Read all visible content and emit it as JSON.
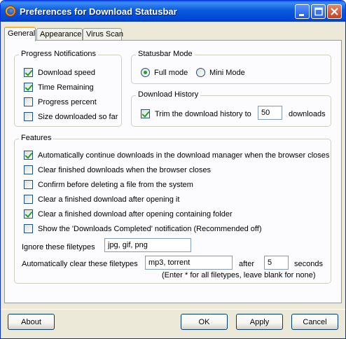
{
  "window": {
    "title": "Preferences for Download Statusbar",
    "title_bar_color": "#0054e3"
  },
  "tabs": [
    {
      "label": "General",
      "active": true
    },
    {
      "label": "Appearance",
      "active": false
    },
    {
      "label": "Virus Scan",
      "active": false
    }
  ],
  "progress_notifications": {
    "legend": "Progress Notifications",
    "options": [
      {
        "label": "Download speed",
        "checked": true
      },
      {
        "label": "Time Remaining",
        "checked": true
      },
      {
        "label": "Progress percent",
        "checked": false
      },
      {
        "label": "Size downloaded so far",
        "checked": false
      }
    ]
  },
  "statusbar_mode": {
    "legend": "Statusbar Mode",
    "options": [
      {
        "label": "Full mode",
        "selected": true
      },
      {
        "label": "Mini Mode",
        "selected": false
      }
    ]
  },
  "download_history": {
    "legend": "Download History",
    "trim_label": "Trim the download history to",
    "trim_checked": true,
    "trim_value": "50",
    "unit": "downloads"
  },
  "features": {
    "legend": "Features",
    "options": [
      {
        "label": "Automatically continue downloads in the download manager when the browser closes",
        "checked": true
      },
      {
        "label": "Clear finished downloads when the browser closes",
        "checked": false
      },
      {
        "label": "Confirm before deleting a file from the system",
        "checked": false
      },
      {
        "label": "Clear a finished download after opening it",
        "checked": false
      },
      {
        "label": "Clear a finished download after opening containing folder",
        "checked": true
      },
      {
        "label": "Show the 'Downloads Completed' notification (Recommended off)",
        "checked": false
      }
    ],
    "ignore_label": "Ignore these filetypes",
    "ignore_value": "jpg, gif, png",
    "autoclear_label": "Automatically clear these filetypes",
    "autoclear_value": "mp3, torrent",
    "after_label": "after",
    "after_value": "5",
    "seconds_label": "seconds",
    "hint": "(Enter * for all filetypes, leave blank for none)"
  },
  "buttons": {
    "about": "About",
    "ok": "OK",
    "apply": "Apply",
    "cancel": "Cancel"
  }
}
